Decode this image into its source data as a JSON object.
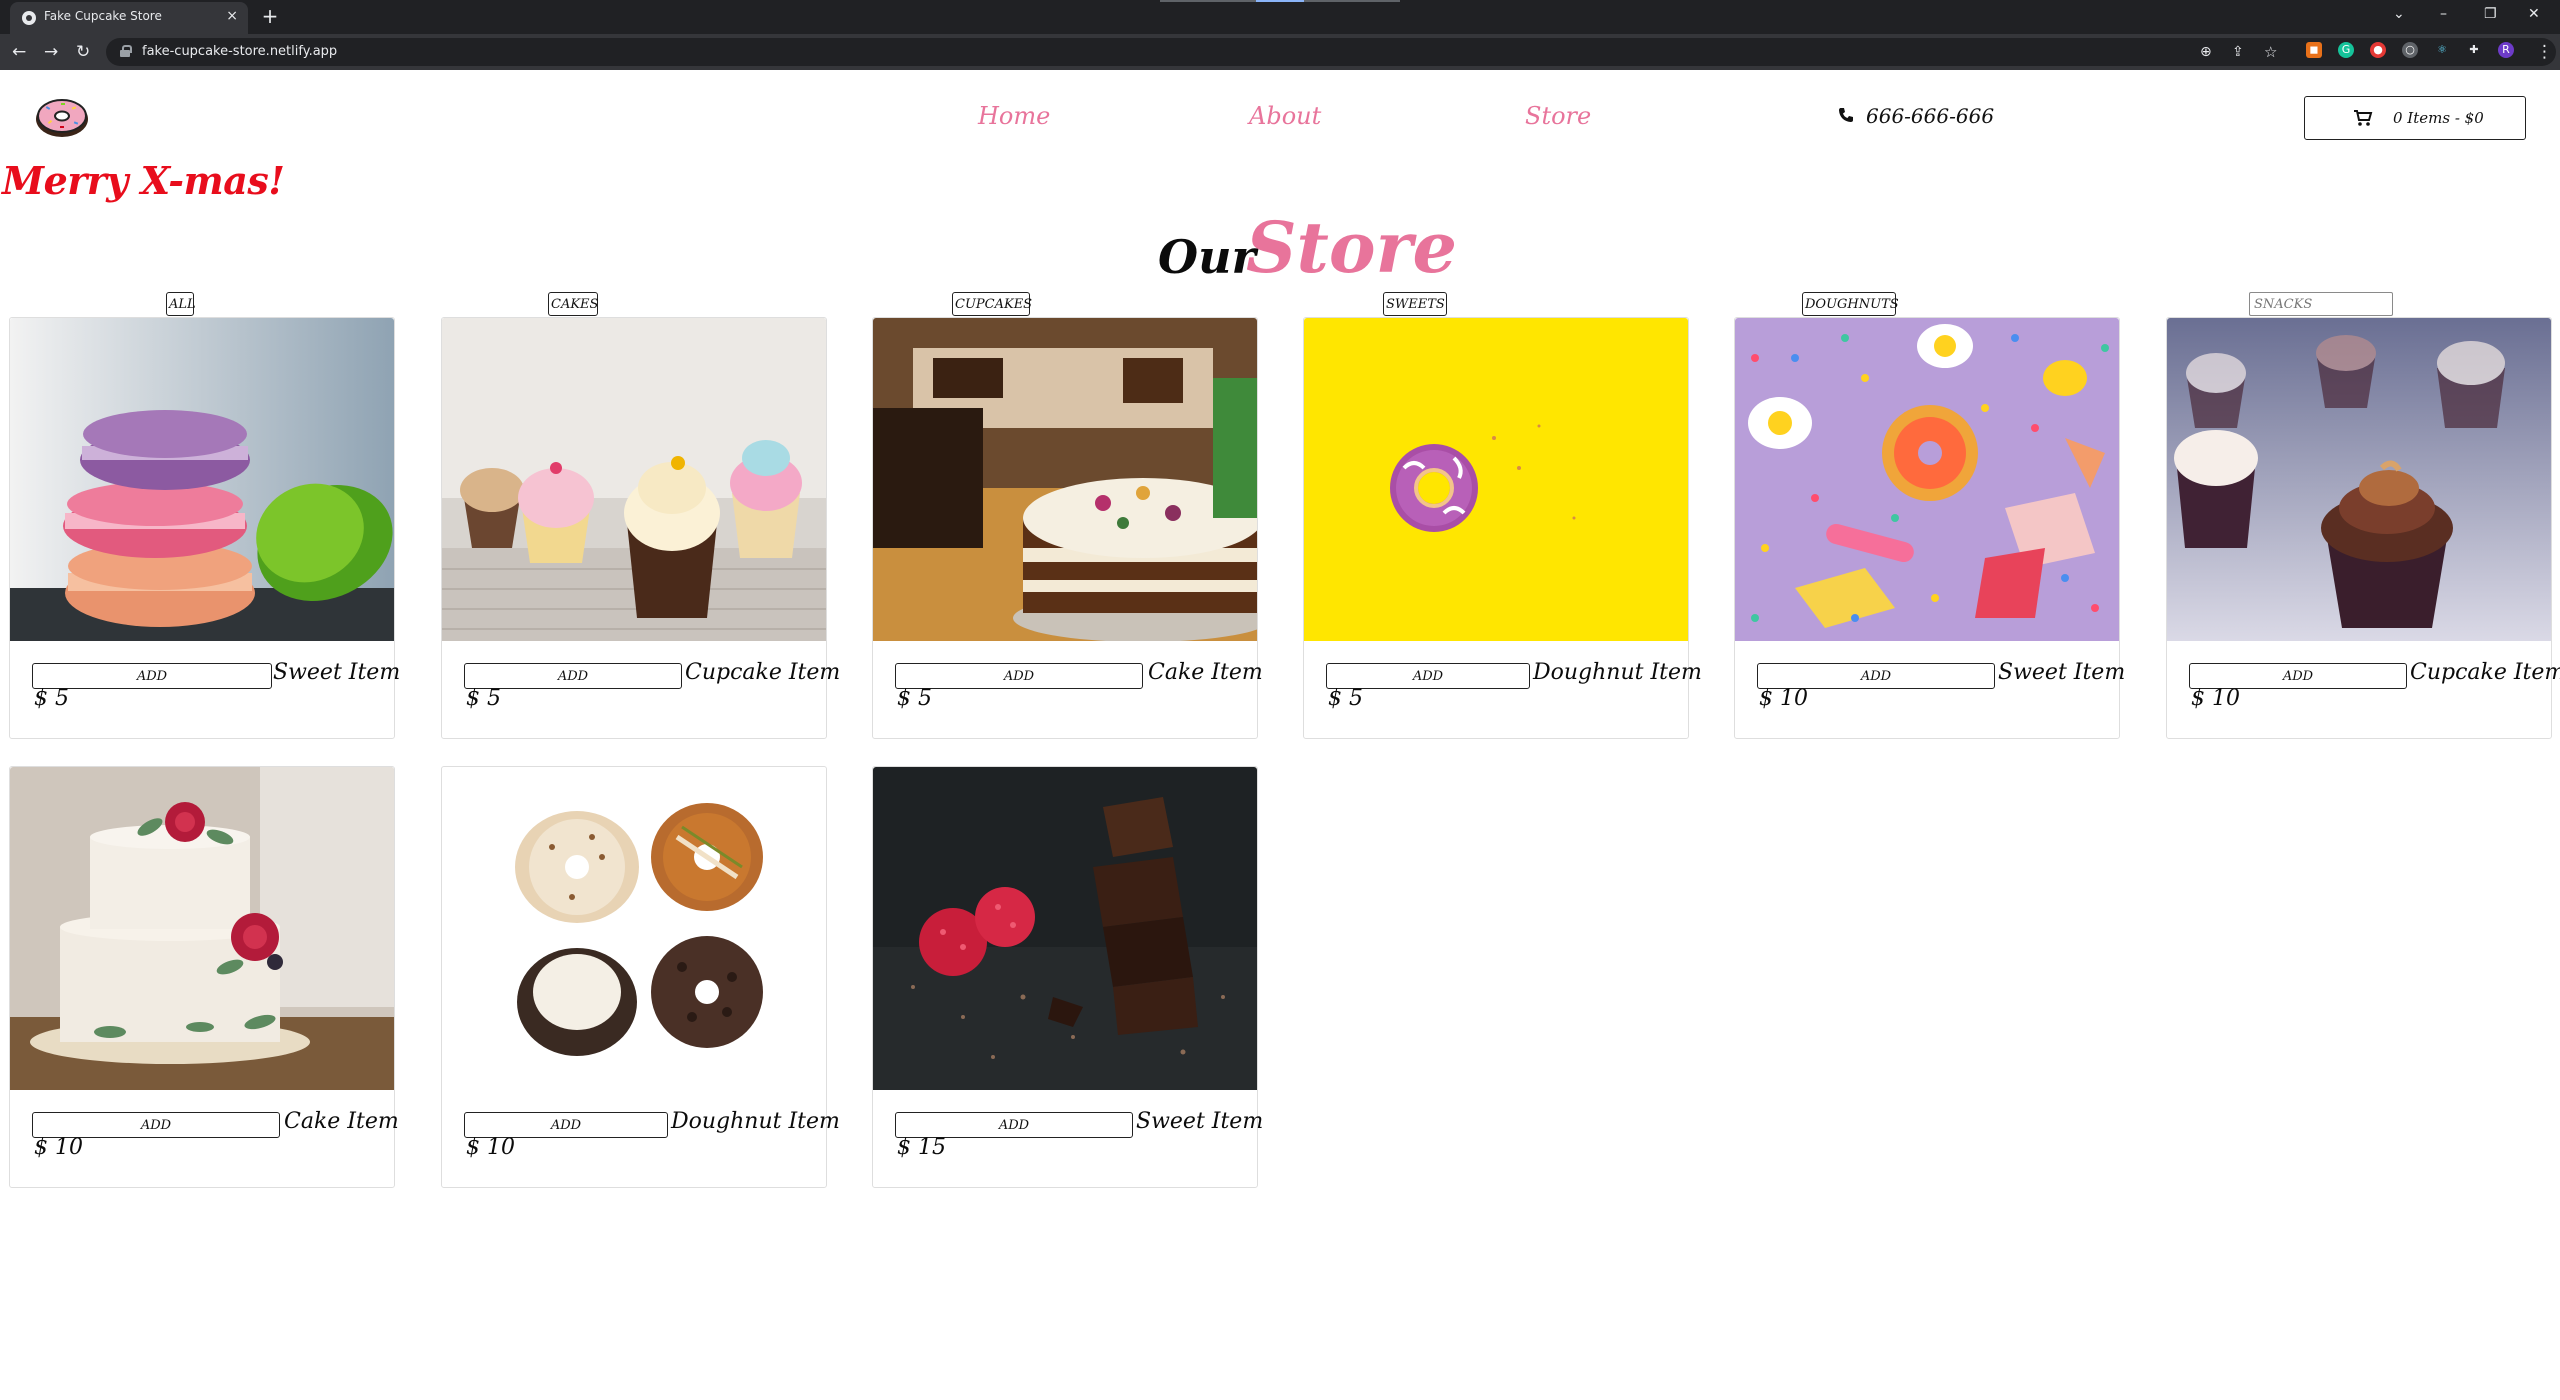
{
  "browser": {
    "tab_title": "Fake Cupcake Store",
    "tab_close": "×",
    "new_tab": "+",
    "url": "fake-cupcake-store.netlify.app",
    "profile_initial": "R"
  },
  "header": {
    "nav": [
      "Home",
      "About",
      "Store"
    ],
    "phone": "666-666-666",
    "cart": "0 Items - $0"
  },
  "banner": "Merry X-mas!",
  "heading": {
    "part1": "Our",
    "part2": "Store"
  },
  "filters": {
    "buttons": [
      "ALL",
      "CAKES",
      "CUPCAKES",
      "SWEETS",
      "DOUGHNUTS"
    ],
    "search_placeholder": "SNACKS"
  },
  "products": [
    {
      "title": "Sweet Item",
      "price": "$ 5",
      "add": "ADD",
      "image": "macarons-stack"
    },
    {
      "title": "Cupcake Item",
      "price": "$ 5",
      "add": "ADD",
      "image": "cupcakes-row"
    },
    {
      "title": "Cake Item",
      "price": "$ 5",
      "add": "ADD",
      "image": "layer-cake-table"
    },
    {
      "title": "Doughnut Item",
      "price": "$ 5",
      "add": "ADD",
      "image": "donut-on-yellow"
    },
    {
      "title": "Sweet Item",
      "price": "$ 10",
      "add": "ADD",
      "image": "candy-on-purple"
    },
    {
      "title": "Cupcake Item",
      "price": "$ 10",
      "add": "ADD",
      "image": "chocolate-cupcakes"
    },
    {
      "title": "Cake Item",
      "price": "$ 10",
      "add": "ADD",
      "image": "wedding-cake"
    },
    {
      "title": "Doughnut Item",
      "price": "$ 10",
      "add": "ADD",
      "image": "four-doughnuts"
    },
    {
      "title": "Sweet Item",
      "price": "$ 15",
      "add": "ADD",
      "image": "chocolate-raspberries"
    }
  ],
  "colors": {
    "accent_pink": "#e8749b",
    "banner_red": "#e80d1c",
    "chrome_dark": "#202124"
  }
}
